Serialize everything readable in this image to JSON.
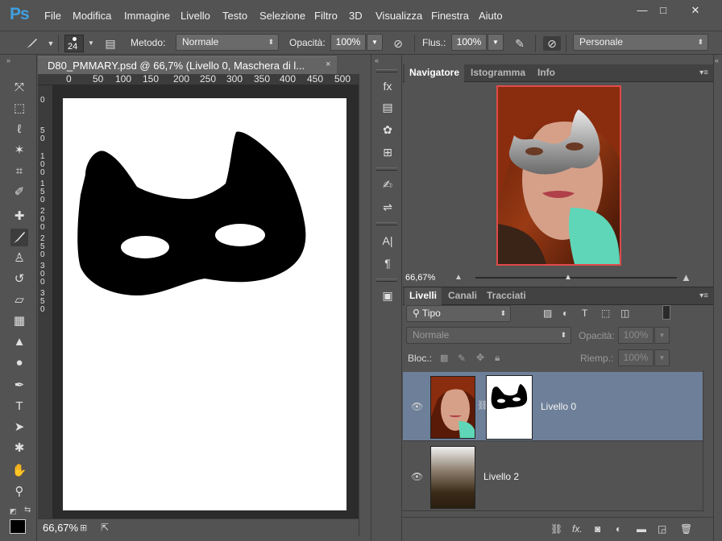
{
  "app": {
    "logo": "Ps"
  },
  "menu": [
    "File",
    "Modifica",
    "Immagine",
    "Livello",
    "Testo",
    "Selezione",
    "Filtro",
    "3D",
    "Visualizza",
    "Finestra",
    "Aiuto"
  ],
  "window_controls": {
    "minimize": "—",
    "maximize": "□",
    "close": "✕"
  },
  "options": {
    "brush_size": "24",
    "mode_label": "Metodo:",
    "mode_value": "Normale",
    "opacity_label": "Opacità:",
    "opacity_value": "100%",
    "flow_label": "Flus.:",
    "flow_value": "100%",
    "preset_value": "Personale"
  },
  "document": {
    "tab_title": "D80_PMMARY.psd @ 66,7% (Livello 0, Maschera di l...",
    "close": "×",
    "ruler_top": [
      "0",
      "50",
      "100",
      "150",
      "200",
      "250",
      "300",
      "350",
      "400",
      "450",
      "500"
    ],
    "ruler_left": [
      "0",
      "5\n0",
      "1\n0\n0",
      "1\n5\n0",
      "2\n0\n0",
      "2\n5\n0",
      "3\n0\n0",
      "3\n5\n0"
    ],
    "zoom": "66,67%"
  },
  "navigator": {
    "tabs": [
      "Navigatore",
      "Istogramma",
      "Info"
    ],
    "zoom": "66,67%"
  },
  "layers": {
    "tabs": [
      "Livelli",
      "Canali",
      "Tracciati"
    ],
    "filter_value": "Tipo",
    "blend_value": "Normale",
    "opacity_label": "Opacità:",
    "opacity_value": "100%",
    "lock_label": "Bloc.:",
    "fill_label": "Riemp.:",
    "fill_value": "100%",
    "items": [
      {
        "name": "Livello 0",
        "selected": true
      },
      {
        "name": "Livello 2",
        "selected": false
      }
    ],
    "bottom_icons": [
      "link-icon",
      "fx-icon",
      "mask-icon",
      "adjustment-icon",
      "folder-icon",
      "new-layer-icon",
      "trash-icon"
    ],
    "fx_label": "fx."
  },
  "colors": {
    "selection": "#6e8099",
    "accent": "#3fa0e0",
    "nav_frame": "#e04a4a"
  }
}
